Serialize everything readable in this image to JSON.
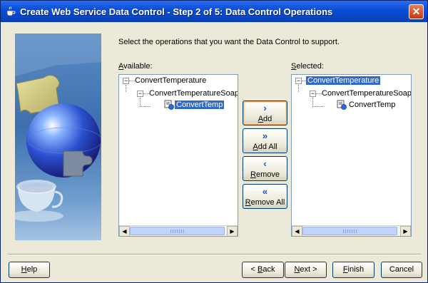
{
  "window": {
    "title": "Create Web Service Data Control - Step 2 of 5: Data Control Operations",
    "close_glyph": "✕"
  },
  "instruction": "Select the operations that you want the Data Control to support.",
  "available": {
    "label_mnemonic": "A",
    "label_rest": "vailable:",
    "tree": {
      "root": "ConvertTemperature",
      "child": "ConvertTemperatureSoap",
      "leaf": "ConvertTemp",
      "selected": "ConvertTemp"
    }
  },
  "selected": {
    "label_mnemonic": "S",
    "label_rest": "elected:",
    "tree": {
      "root": "ConvertTemperature",
      "child": "ConvertTemperatureSoap",
      "leaf": "ConvertTemp",
      "selected": "ConvertTemperature"
    }
  },
  "move_buttons": [
    {
      "glyph": "›",
      "mnemonic": "A",
      "rest": "dd",
      "icon": "chevron-right-icon"
    },
    {
      "glyph": "»",
      "mnemonic": "A",
      "rest": "dd All",
      "icon": "double-chevron-right-icon"
    },
    {
      "glyph": "‹",
      "mnemonic": "R",
      "rest": "emove",
      "icon": "chevron-left-icon"
    },
    {
      "glyph": "«",
      "mnemonic": "R",
      "rest": "emove All",
      "icon": "double-chevron-left-icon"
    }
  ],
  "footer": {
    "help": {
      "mnemonic": "H",
      "rest": "elp"
    },
    "back": {
      "prefix": "< ",
      "mnemonic": "B",
      "rest": "ack"
    },
    "next": {
      "mnemonic": "N",
      "rest": "ext >"
    },
    "finish": {
      "mnemonic": "F",
      "rest": "inish"
    },
    "cancel": "Cancel"
  },
  "scroll": {
    "left_glyph": "◀",
    "right_glyph": "▶"
  }
}
